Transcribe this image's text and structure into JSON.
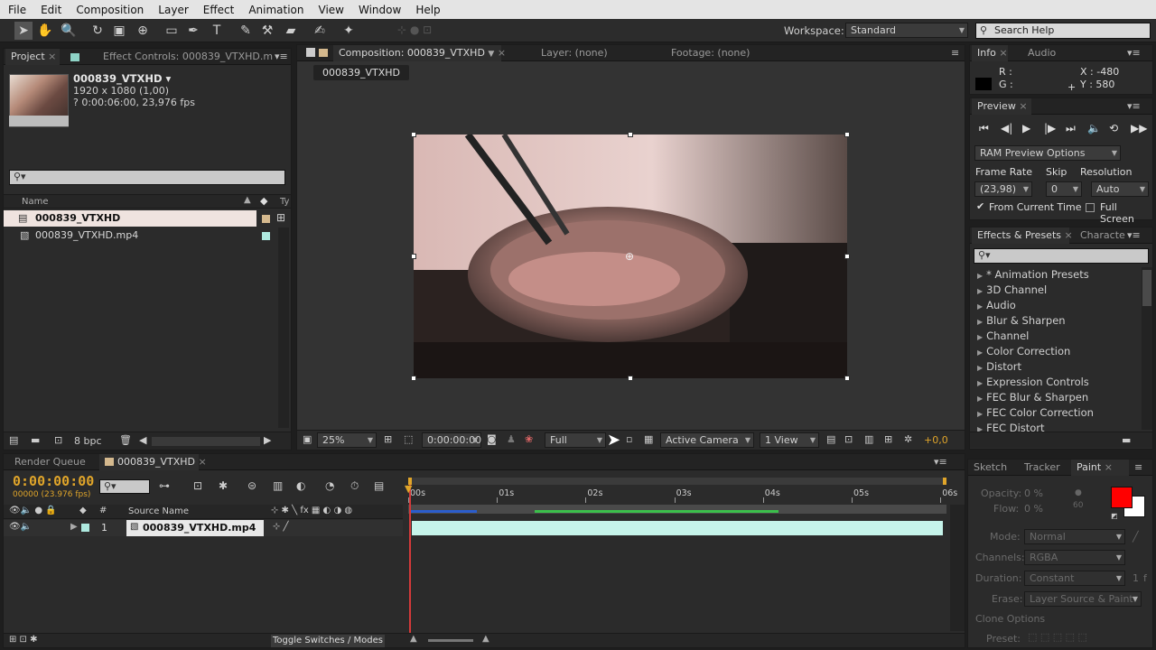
{
  "menu": [
    "File",
    "Edit",
    "Composition",
    "Layer",
    "Effect",
    "Animation",
    "View",
    "Window",
    "Help"
  ],
  "toolbar": {
    "tools": [
      {
        "name": "selection-tool-icon",
        "glyph": "➤"
      },
      {
        "name": "hand-tool-icon",
        "glyph": "✋"
      },
      {
        "name": "zoom-tool-icon",
        "glyph": "🔍"
      },
      {
        "name": "rotate-tool-icon",
        "glyph": "↻"
      },
      {
        "name": "camera-tool-icon",
        "glyph": "▣"
      },
      {
        "name": "pan-behind-tool-icon",
        "glyph": "⊕"
      },
      {
        "name": "rectangle-tool-icon",
        "glyph": "▭"
      },
      {
        "name": "pen-tool-icon",
        "glyph": "✒"
      },
      {
        "name": "type-tool-icon",
        "glyph": "T"
      },
      {
        "name": "brush-tool-icon",
        "glyph": "✎"
      },
      {
        "name": "clone-stamp-tool-icon",
        "glyph": "⚒"
      },
      {
        "name": "eraser-tool-icon",
        "glyph": "▰"
      },
      {
        "name": "roto-brush-tool-icon",
        "glyph": "✍"
      },
      {
        "name": "puppet-pin-tool-icon",
        "glyph": "✦"
      }
    ],
    "workspace_label": "Workspace:",
    "workspace_value": "Standard",
    "search_placeholder": "Search Help"
  },
  "project": {
    "tab_project": "Project",
    "tab_effect_controls": "Effect Controls: 000839_VTXHD.m",
    "item_name": "000839_VTXHD ▾",
    "item_size": "1920 x 1080 (1,00)",
    "item_duration": "? 0:00:06:00, 23,976 fps",
    "col_name": "Name",
    "col_type": "Ty",
    "items": [
      {
        "label": "000839_VTXHD",
        "selected": true
      },
      {
        "label": "000839_VTXHD.mp4",
        "selected": false
      }
    ],
    "bpc": "8 bpc"
  },
  "composition": {
    "tab_comp": "Composition: 000839_VTXHD",
    "tab_layer": "Layer: (none)",
    "tab_footage": "Footage: (none)",
    "comp_chip": "000839_VTXHD",
    "zoom": "25%",
    "timecode": "0:00:00:00",
    "resolution": "Full",
    "camera": "Active Camera",
    "views": "1 View",
    "exposure": "+0,0"
  },
  "info": {
    "tab_info": "Info",
    "tab_audio": "Audio",
    "r_label": "R :",
    "g_label": "G :",
    "x_label": "X : -480",
    "y_label": "Y : 580"
  },
  "preview": {
    "tab": "Preview",
    "ram_options": "RAM Preview Options",
    "frame_rate_label": "Frame Rate",
    "skip_label": "Skip",
    "resolution_label": "Resolution",
    "frame_rate_value": "(23,98)",
    "skip_value": "0",
    "resolution_value": "Auto",
    "from_current": "From Current Time",
    "full_screen": "Full Screen"
  },
  "effects": {
    "tab": "Effects & Presets",
    "tab_character": "Characte",
    "items": [
      "* Animation Presets",
      "3D Channel",
      "Audio",
      "Blur & Sharpen",
      "Channel",
      "Color Correction",
      "Distort",
      "Expression Controls",
      "FEC Blur & Sharpen",
      "FEC Color Correction",
      "FEC Distort"
    ]
  },
  "timeline": {
    "tab_render": "Render Queue",
    "tab_comp": "000839_VTXHD",
    "timecode": "0:00:00:00",
    "frames": "00000 (23.976 fps)",
    "col_source": "Source Name",
    "layer_num": "1",
    "layer_name": "000839_VTXHD.mp4",
    "ruler": [
      "00s",
      "01s",
      "02s",
      "03s",
      "04s",
      "05s",
      "06s"
    ],
    "toggle": "Toggle Switches / Modes"
  },
  "paint": {
    "tab_sketch": "Sketch",
    "tab_tracker": "Tracker",
    "tab_paint": "Paint",
    "opacity": "Opacity:",
    "opacity_val": "0 %",
    "flow": "Flow:",
    "flow_val": "0 %",
    "brush_size": "60",
    "mode_label": "Mode:",
    "mode_val": "Normal",
    "channels_label": "Channels:",
    "channels_val": "RGBA",
    "duration_label": "Duration:",
    "duration_val": "Constant",
    "duration_num": "1",
    "duration_f": "f",
    "erase_label": "Erase:",
    "erase_val": "Layer Source & Paint",
    "clone_options": "Clone Options",
    "preset_label": "Preset:",
    "fg_color": "#ff0000",
    "bg_color": "#ffffff"
  }
}
